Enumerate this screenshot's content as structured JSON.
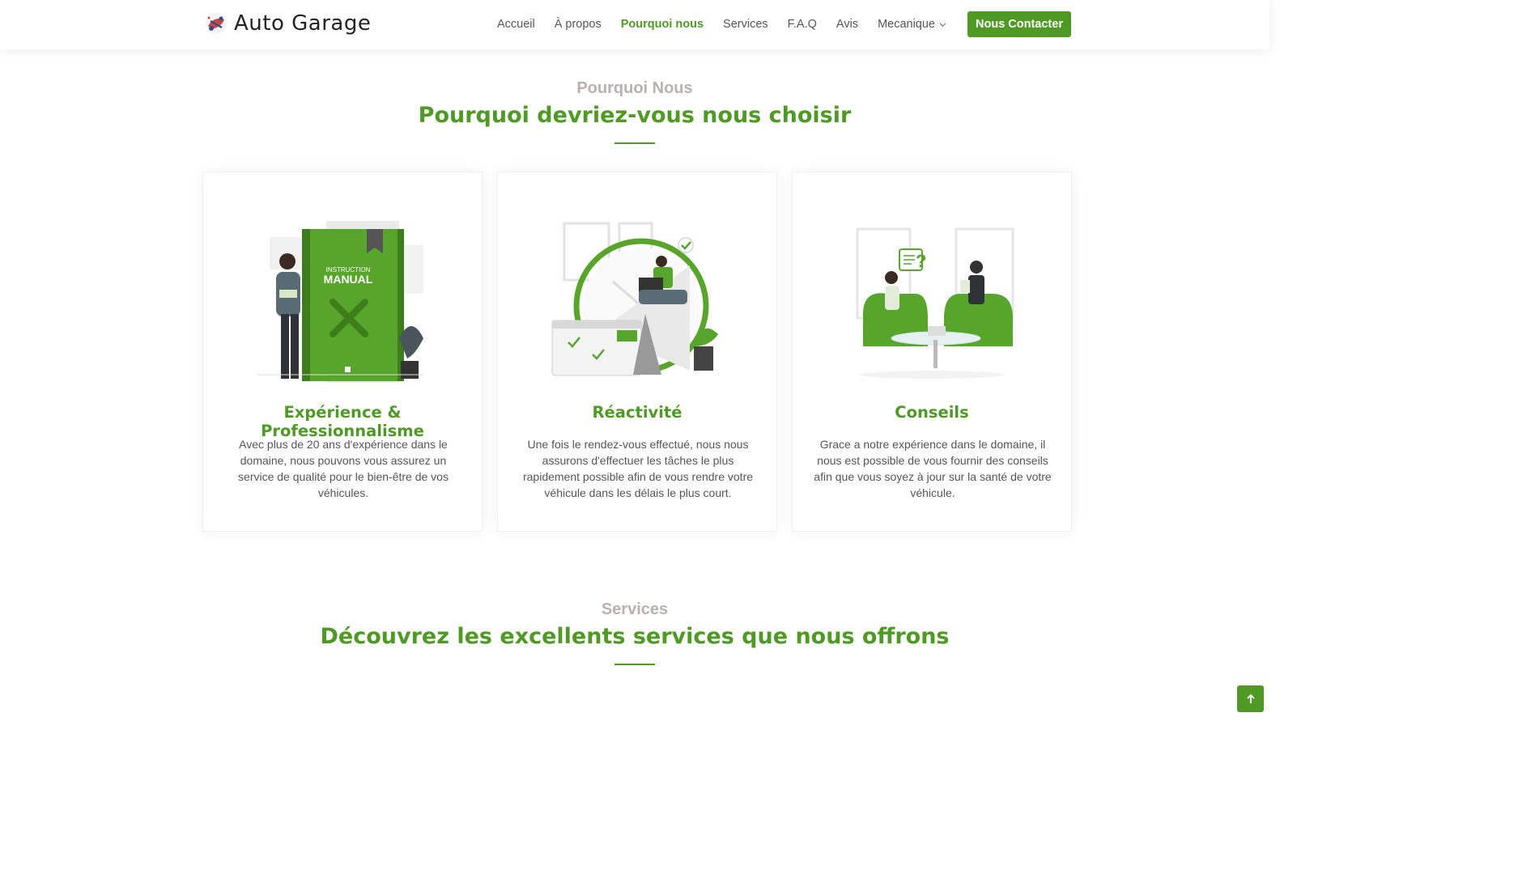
{
  "brand": {
    "name": "Auto Garage",
    "logo_icon": "garage-logo-icon"
  },
  "nav": {
    "items": [
      {
        "label": "Accueil",
        "active": false
      },
      {
        "label": "À propos",
        "active": false
      },
      {
        "label": "Pourquoi nous",
        "active": true
      },
      {
        "label": "Services",
        "active": false
      },
      {
        "label": "F.A.Q",
        "active": false
      },
      {
        "label": "Avis",
        "active": false
      },
      {
        "label": "Mecanique",
        "active": false,
        "dropdown": true
      }
    ],
    "cta_label": "Nous Contacter"
  },
  "why": {
    "eyebrow": "Pourquoi Nous",
    "headline": "Pourquoi devriez-vous nous choisir",
    "cards": [
      {
        "title": "Expérience & Professionnalisme",
        "text": "Avec plus de 20 ans d'expérience dans le domaine, nous pouvons vous assurez un service de qualité pour le bien-être de vos véhicules.",
        "illustration": "instruction-manual-illustration",
        "art_labels": [
          "INSTRUCTION",
          "MANUAL"
        ]
      },
      {
        "title": "Réactivité",
        "text": "Une fois le rendez-vous effectué, nous nous assurons d'effectuer les tâches le plus rapidement possible afin de vous rendre votre véhicule dans les délais le plus court.",
        "illustration": "clock-calendar-illustration"
      },
      {
        "title": "Conseils",
        "text": "Grace a notre expérience dans le domaine, il nous est possible de vous fournir des conseils afin que vous soyez à jour sur la santé de votre véhicule.",
        "illustration": "consultation-illustration"
      }
    ]
  },
  "services": {
    "eyebrow": "Services",
    "headline": "Découvrez les excellents services que nous offrons"
  },
  "colors": {
    "accent": "#4e9a24",
    "muted": "#b7b2ae",
    "text": "#555555"
  },
  "back_to_top_icon": "arrow-up-icon"
}
